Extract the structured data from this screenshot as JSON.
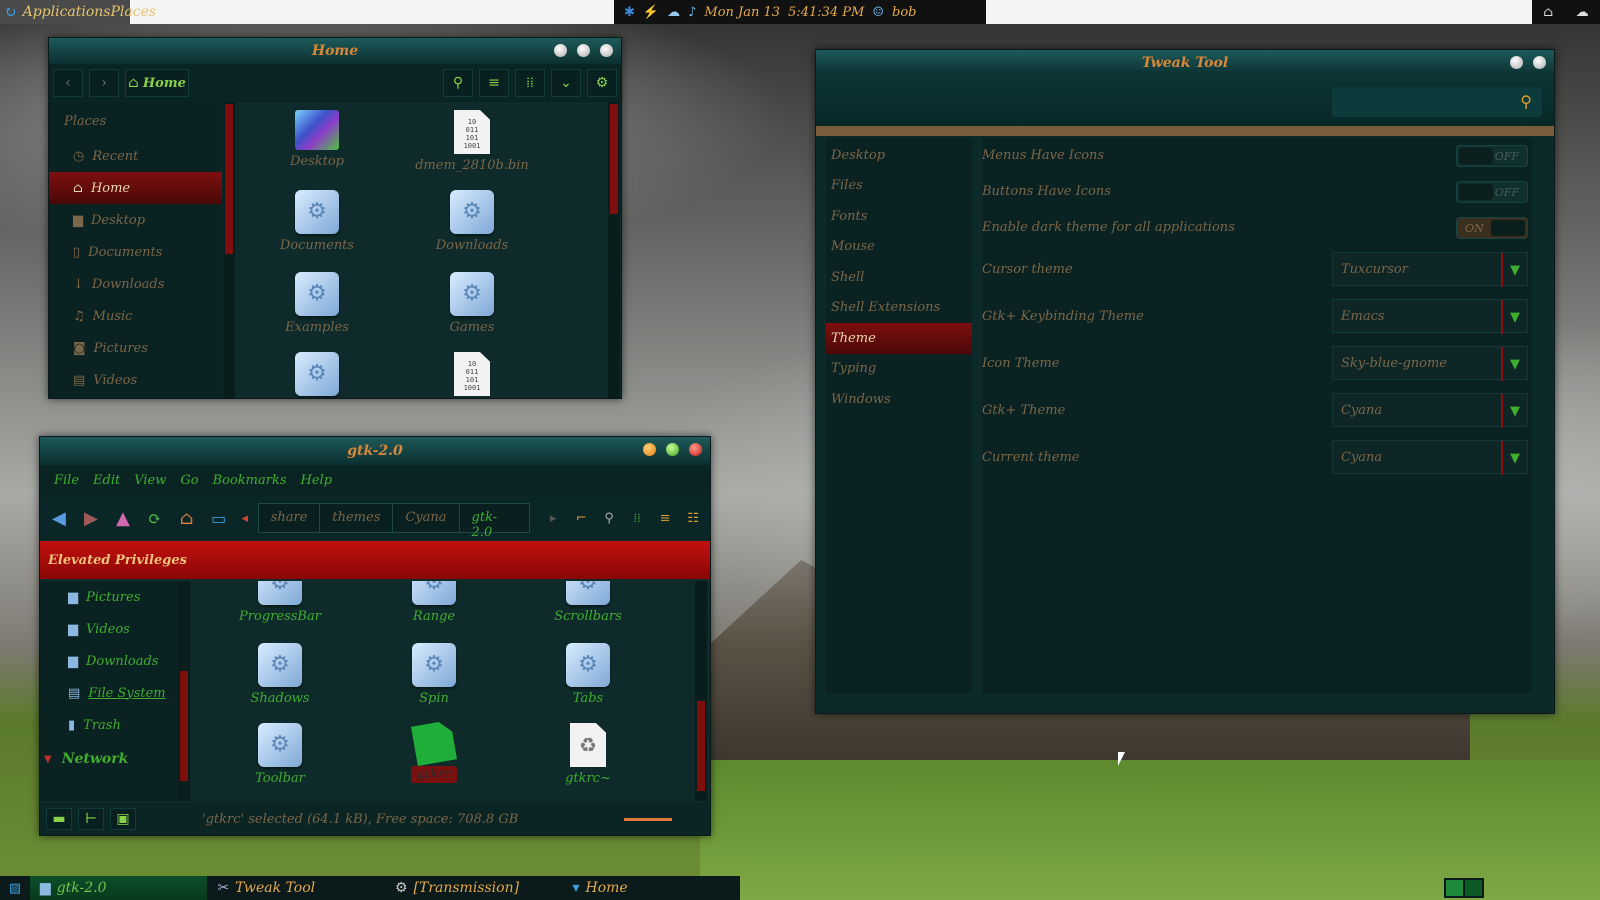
{
  "top_panel": {
    "menu_label": "ApplicationsPlaces",
    "date": "Mon Jan 13",
    "time": "5:41:34 PM",
    "user": "bob"
  },
  "home_window": {
    "title": "Home",
    "location_label": "Home",
    "sidebar_heading": "Places",
    "sidebar": [
      {
        "label": "Recent",
        "icon": "clock-icon"
      },
      {
        "label": "Home",
        "icon": "home-icon",
        "selected": true
      },
      {
        "label": "Desktop",
        "icon": "folder-icon"
      },
      {
        "label": "Documents",
        "icon": "document-icon"
      },
      {
        "label": "Downloads",
        "icon": "download-icon"
      },
      {
        "label": "Music",
        "icon": "music-icon"
      },
      {
        "label": "Pictures",
        "icon": "camera-icon"
      },
      {
        "label": "Videos",
        "icon": "film-icon"
      }
    ],
    "files": [
      "Desktop",
      "dmem_2810b.bin",
      "Documents",
      "Downloads",
      "Examples",
      "Games"
    ]
  },
  "gtk_window": {
    "title": "gtk-2.0",
    "menu": [
      "File",
      "Edit",
      "View",
      "Go",
      "Bookmarks",
      "Help"
    ],
    "breadcrumb": [
      "share",
      "themes",
      "Cyana",
      "gtk-2.0"
    ],
    "privileges_banner": "Elevated Privileges",
    "sidebar": [
      {
        "label": "Pictures"
      },
      {
        "label": "Videos"
      },
      {
        "label": "Downloads"
      },
      {
        "label": "File System"
      },
      {
        "label": "Trash"
      }
    ],
    "network_heading": "Network",
    "files": [
      "ProgressBar",
      "Range",
      "Scrollbars",
      "Shadows",
      "Spin",
      "Tabs",
      "Toolbar",
      "gtkrc",
      "gtkrc~"
    ],
    "status": "'gtkrc' selected (64.1 kB), Free space: 708.8 GB"
  },
  "tweak_window": {
    "title": "Tweak Tool",
    "categories": [
      "Desktop",
      "Files",
      "Fonts",
      "Mouse",
      "Shell",
      "Shell Extensions",
      "Theme",
      "Typing",
      "Windows"
    ],
    "selected_category": "Theme",
    "toggles": [
      {
        "label": "Menus Have Icons",
        "state": "OFF"
      },
      {
        "label": "Buttons Have Icons",
        "state": "OFF"
      },
      {
        "label": "Enable dark theme for all applications",
        "state": "ON"
      }
    ],
    "combos": [
      {
        "label": "Cursor theme",
        "value": "Tuxcursor"
      },
      {
        "label": "Gtk+ Keybinding Theme",
        "value": "Emacs"
      },
      {
        "label": "Icon Theme",
        "value": "Sky-blue-gnome"
      },
      {
        "label": "Gtk+ Theme",
        "value": "Cyana"
      },
      {
        "label": "Current theme",
        "value": "Cyana"
      }
    ]
  },
  "taskbar": [
    {
      "label": "gtk-2.0",
      "active": true
    },
    {
      "label": "Tweak Tool"
    },
    {
      "label": "[Transmission]"
    },
    {
      "label": "Home"
    }
  ],
  "colors": {
    "accent_green": "#3fae2e",
    "accent_red": "#7d0f0f",
    "text_brown": "#7a6648",
    "panel_orange": "#e4a94d"
  }
}
